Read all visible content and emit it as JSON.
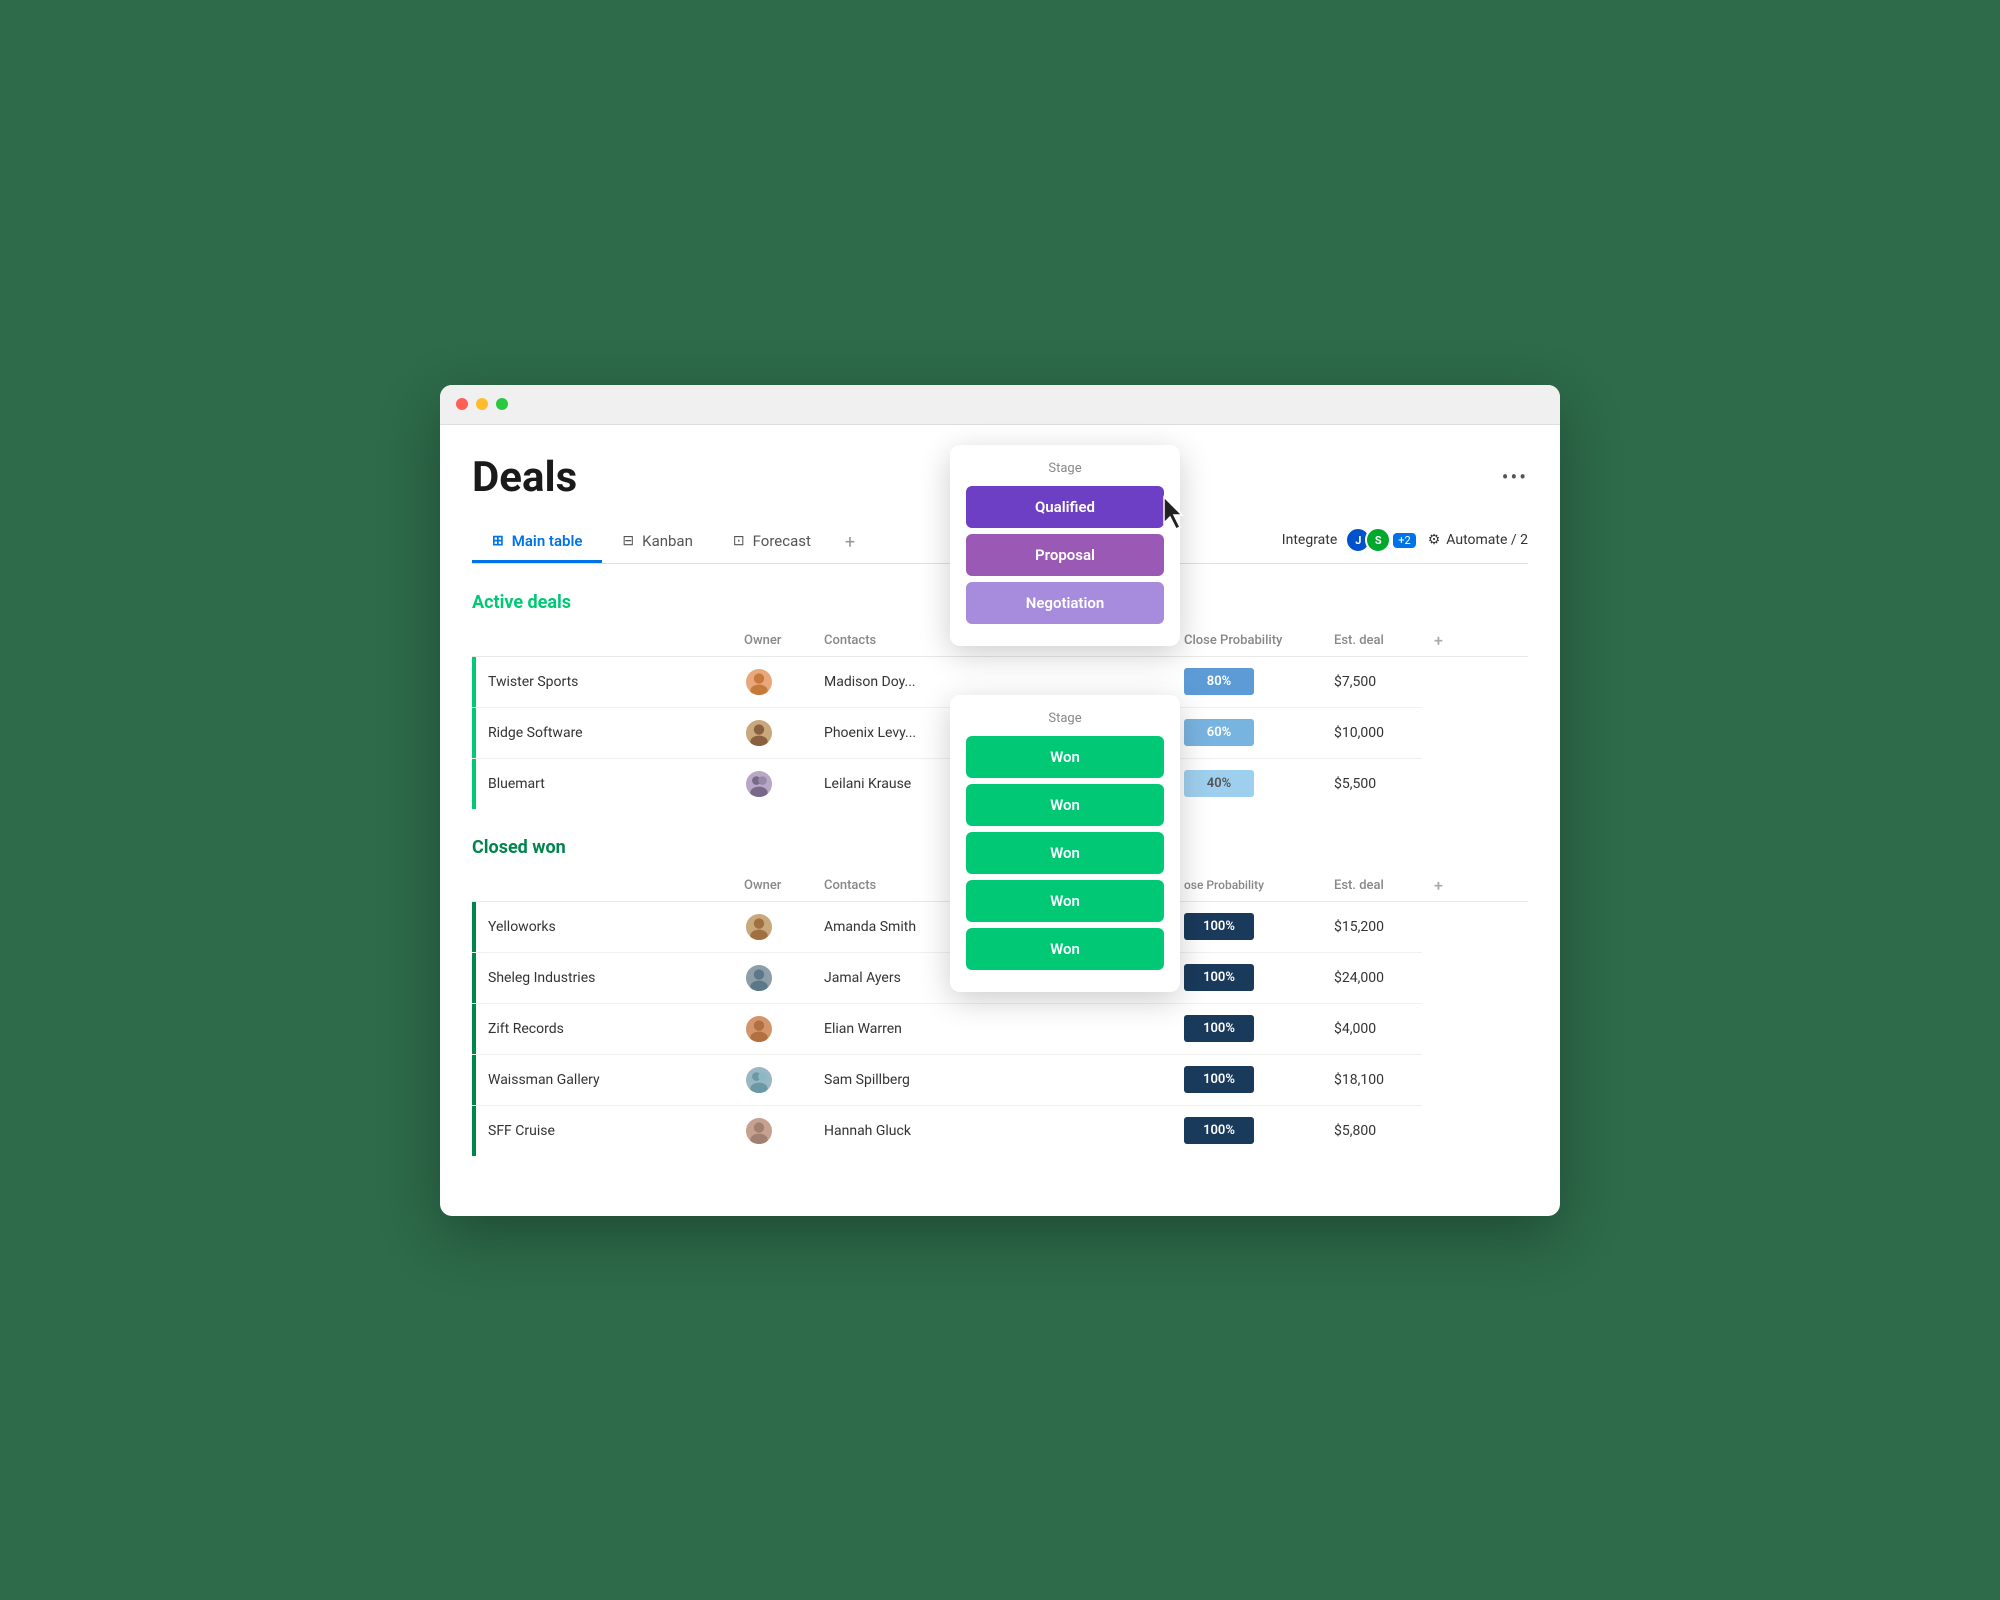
{
  "page": {
    "title": "Deals",
    "more_menu": "•••"
  },
  "tabs": [
    {
      "id": "main-table",
      "label": "Main table",
      "icon": "⊞",
      "active": true
    },
    {
      "id": "kanban",
      "label": "Kanban",
      "icon": "⊟",
      "active": false
    },
    {
      "id": "forecast",
      "label": "Forecast",
      "icon": "⊡",
      "active": false
    },
    {
      "id": "add",
      "label": "+",
      "active": false
    }
  ],
  "actions": {
    "integrate_label": "Integrate",
    "integrate_badge": "+2",
    "automate_label": "Automate / 2"
  },
  "active_deals": {
    "section_title": "Active deals",
    "columns": {
      "owner": "Owner",
      "contacts": "Contacts",
      "stage": "Stage",
      "close_prob": "Close Probability",
      "est_deal": "Est. deal"
    },
    "rows": [
      {
        "name": "Twister Sports",
        "owner_color": "#e8a87c",
        "contacts": "Madison Doy...",
        "stage": "Negotiation",
        "prob": "80%",
        "prob_class": "prob-80",
        "est_deal": "$7,500"
      },
      {
        "name": "Ridge Software",
        "owner_color": "#c9a87c",
        "contacts": "Phoenix Levy...",
        "stage": "Proposal",
        "prob": "60%",
        "prob_class": "prob-60",
        "est_deal": "$10,000"
      },
      {
        "name": "Bluemart",
        "owner_color": "#b8a8c8",
        "contacts": "Leilani Krause",
        "stage": "Qualified",
        "prob": "40%",
        "prob_class": "prob-40",
        "est_deal": "$5,500"
      }
    ]
  },
  "closed_won": {
    "section_title": "Closed won",
    "columns": {
      "owner": "Owner",
      "contacts": "Contacts",
      "stage": "Stage",
      "close_prob": "Close Probability",
      "est_deal": "Est. deal"
    },
    "rows": [
      {
        "name": "Yelloworks",
        "owner_color": "#c9a87c",
        "contacts": "Amanda Smith",
        "stage": "Won",
        "prob": "100%",
        "prob_class": "prob-100",
        "est_deal": "$15,200"
      },
      {
        "name": "Sheleg Industries",
        "owner_color": "#8c9ea8",
        "contacts": "Jamal Ayers",
        "stage": "Won",
        "prob": "100%",
        "prob_class": "prob-100",
        "est_deal": "$24,000"
      },
      {
        "name": "Zift Records",
        "owner_color": "#d4956a",
        "contacts": "Elian Warren",
        "stage": "Won",
        "prob": "100%",
        "prob_class": "prob-100",
        "est_deal": "$4,000"
      },
      {
        "name": "Waissman Gallery",
        "owner_color": "#9ab8c4",
        "contacts": "Sam Spillberg",
        "stage": "Won",
        "prob": "100%",
        "prob_class": "prob-100",
        "est_deal": "$18,100"
      },
      {
        "name": "SFF Cruise",
        "owner_color": "#c8a090",
        "contacts": "Hannah Gluck",
        "stage": "Won",
        "prob": "100%",
        "prob_class": "prob-100",
        "est_deal": "$5,800"
      }
    ]
  },
  "dropdown_top": {
    "label": "Stage",
    "options": [
      {
        "value": "Qualified",
        "class": "stage-qualified"
      },
      {
        "value": "Proposal",
        "class": "stage-proposal"
      },
      {
        "value": "Negotiation",
        "class": "stage-negotiation"
      }
    ]
  },
  "dropdown_bottom": {
    "label": "Stage",
    "options": [
      {
        "value": "Won",
        "class": "stage-won"
      },
      {
        "value": "Won",
        "class": "stage-won"
      },
      {
        "value": "Won",
        "class": "stage-won"
      },
      {
        "value": "Won",
        "class": "stage-won"
      },
      {
        "value": "Won",
        "class": "stage-won"
      }
    ]
  }
}
